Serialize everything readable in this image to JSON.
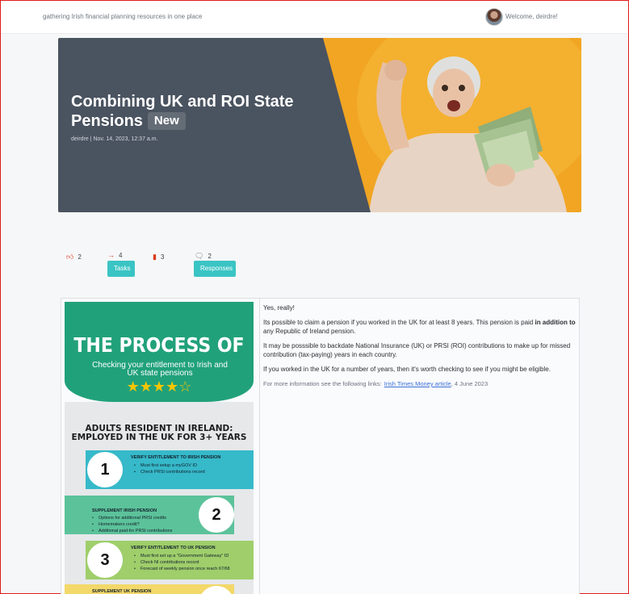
{
  "header": {
    "tagline": "gathering Irish financial planning resources in one place",
    "welcome": "Welcome, deirdre!"
  },
  "hero": {
    "title": "Combining UK and ROI State Pensions",
    "badge": "New",
    "meta": "deirdre | Nov. 14, 2023, 12:37 a.m.",
    "colors": {
      "dark": "#4a5360",
      "accent": "#f1a523"
    }
  },
  "stats": {
    "likes": "2",
    "tasks_count": "4",
    "tasks_label": "Tasks",
    "saves": "3",
    "responses_count": "2",
    "responses_label": "Responses"
  },
  "infographic": {
    "title": "THE PROCESS OF",
    "subtitle": "Checking your entitlement to Irish and UK state pensions",
    "rating": 4,
    "rating_max": 5,
    "section": "ADULTS RESIDENT IN IRELAND: EMPLOYED IN THE UK FOR 3+ YEARS",
    "steps": [
      {
        "number": "1",
        "title": "VERIFY ENTITLEMENT TO IRISH PENSION",
        "items": [
          "Must first setup a myGOV ID",
          "Check PRSI contributions record"
        ],
        "color": "#36b9c9"
      },
      {
        "number": "2",
        "title": "SUPPLEMENT IRISH  PENSION",
        "items": [
          "Options for additional PRSI credits",
          "Homemakers credit?",
          "Additional paid-for PRSI contributions"
        ],
        "color": "#5cc29a"
      },
      {
        "number": "3",
        "title": "VERIFY ENTITLEMENT TO UK PENSION",
        "items": [
          "Must first set up a \"Government Gateway\" ID",
          "Check NI contributions record",
          "Forecast of weekly pension once reach 67/68"
        ],
        "color": "#9fce6b"
      },
      {
        "title": "SUPPLEMENT UK PENSION",
        "color": "#f3d86a"
      }
    ]
  },
  "article": {
    "intro": "Yes, really!",
    "p1_before": "Its possible to claim a pension if you worked in the UK for at least 8 years. This pension is paid ",
    "p1_bold": "in addition to",
    "p1_after": " any Republic of Ireland pension.",
    "p2": "It may be posssible to backdate National Insurance (UK) or PRSI (ROI) contributions to make up for missed contribution (tax-paying) years in each country.",
    "p3": "If you worked in the UK for a number of years, then it's worth checking to see if you might be eligible.",
    "more_prefix": "For more information see the following links:",
    "link_text": "Irish Times Money article",
    "link_suffix": ", 4 June 2023"
  }
}
